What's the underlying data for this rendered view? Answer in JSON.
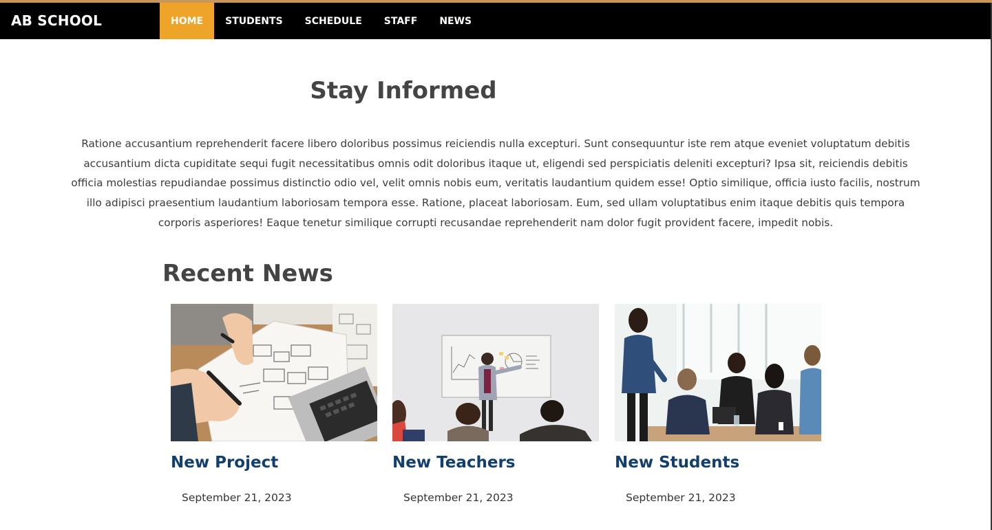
{
  "header": {
    "brand": "AB SCHOOL",
    "nav": [
      "HOME",
      "STUDENTS",
      "SCHEDULE",
      "STAFF",
      "NEWS"
    ],
    "active_index": 0,
    "accent_color": "#eea329",
    "stripe_color": "#c8955a"
  },
  "intro": {
    "title": "Stay Informed",
    "paragraph": "Ratione accusantium reprehenderit facere libero doloribus possimus reiciendis nulla excepturi. Sunt consequuntur iste rem atque eveniet voluptatum debitis accusantium dicta cupiditate sequi fugit necessitatibus omnis odit doloribus itaque ut, eligendi sed perspiciatis deleniti excepturi? Ipsa sit, reiciendis debitis officia molestias repudiandae possimus distinctio odio vel, velit omnis nobis eum, veritatis laudantium quidem esse! Optio similique, officia iusto facilis, nostrum illo adipisci praesentium laudantium laboriosam tempora esse. Ratione, placeat laboriosam. Eum, sed ullam voluptatibus enim itaque debitis quis tempora corporis asperiores! Eaque tenetur similique corrupti recusandae reprehenderit nam dolor fugit provident facere, impedit nobis."
  },
  "news": {
    "heading": "Recent News",
    "title_color": "#123f6e",
    "items": [
      {
        "title": "New Project",
        "date": "September 21, 2023",
        "image": "wireframe-sketch-photo"
      },
      {
        "title": "New Teachers",
        "date": "September 21, 2023",
        "image": "whiteboard-presentation-photo"
      },
      {
        "title": "New Students",
        "date": "September 21, 2023",
        "image": "classroom-discussion-photo"
      }
    ]
  }
}
